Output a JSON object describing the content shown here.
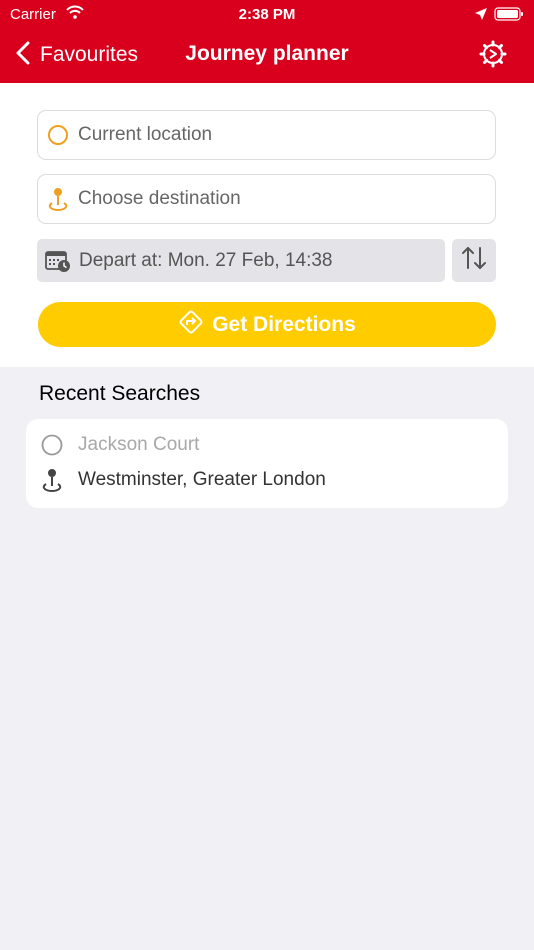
{
  "status_bar": {
    "carrier": "Carrier",
    "time": "2:38 PM"
  },
  "nav": {
    "back_label": "Favourites",
    "title": "Journey planner"
  },
  "planner": {
    "origin_placeholder": "Current location",
    "destination_placeholder": "Choose destination",
    "depart_text": "Depart at: Mon. 27 Feb, 14:38",
    "directions_label": "Get Directions"
  },
  "recent": {
    "title": "Recent Searches",
    "items": [
      {
        "from": "Jackson Court",
        "to": "Westminster, Greater London"
      }
    ]
  },
  "colors": {
    "brand_red": "#d9001e",
    "accent_yellow": "#ffcc00",
    "origin_orange": "#f0a020",
    "background": "#f0f0f5"
  }
}
